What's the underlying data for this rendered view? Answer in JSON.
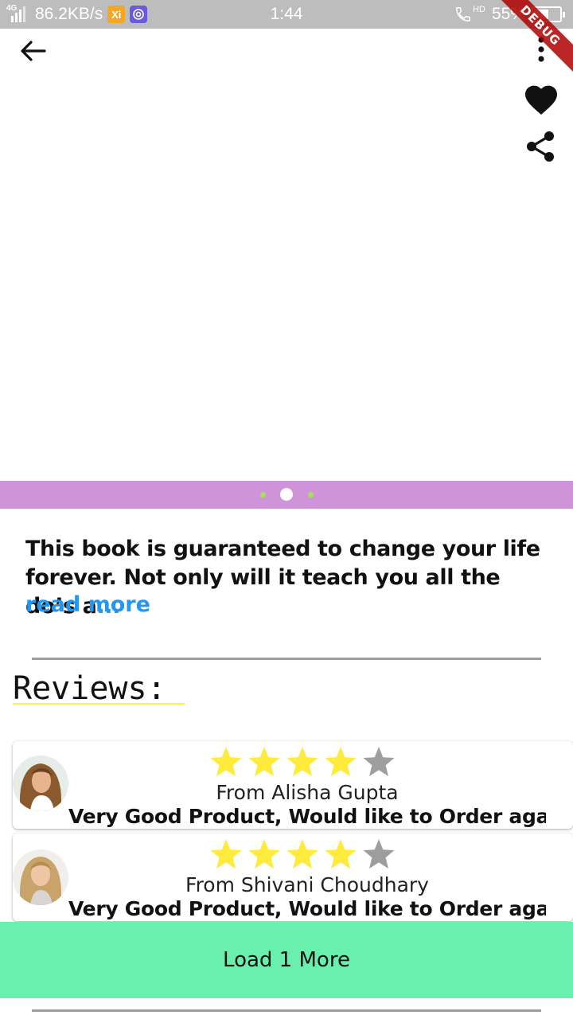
{
  "status_bar": {
    "network": "4G",
    "speed": "86.2KB/s",
    "app_icon_1": "Xi",
    "time": "1:44",
    "call_icon_label": "HD",
    "battery": "55%",
    "battery_level": 0.55
  },
  "debug_banner": "DEBUG",
  "header": {
    "back_icon": "arrow-left-icon",
    "more_icon": "more-vert-icon",
    "favorite_icon": "heart-icon",
    "share_icon": "share-icon"
  },
  "carousel": {
    "strip_color": "#ce93d8",
    "dot_count": 3,
    "active_index": 1
  },
  "description": {
    "text": "This book is guaranteed to change your life forever. Not only will it teach you all the do’s a",
    "ellipsis": "...",
    "read_more": "read more"
  },
  "reviews": {
    "title": "Reviews:",
    "items": [
      {
        "rating": 4,
        "max_rating": 5,
        "from": "From Alisha Gupta",
        "text": "Very Good Product, Would like to Order agai..."
      },
      {
        "rating": 4,
        "max_rating": 5,
        "from": "From Shivani Choudhary",
        "text": "Very Good Product, Would like to Order agai..."
      }
    ]
  },
  "load_more": {
    "label": "Load 1 More",
    "color": "#69f0ae"
  },
  "colors": {
    "star_filled": "#ffeb3b",
    "star_empty": "#9e9e9e",
    "link": "#2196f3"
  }
}
